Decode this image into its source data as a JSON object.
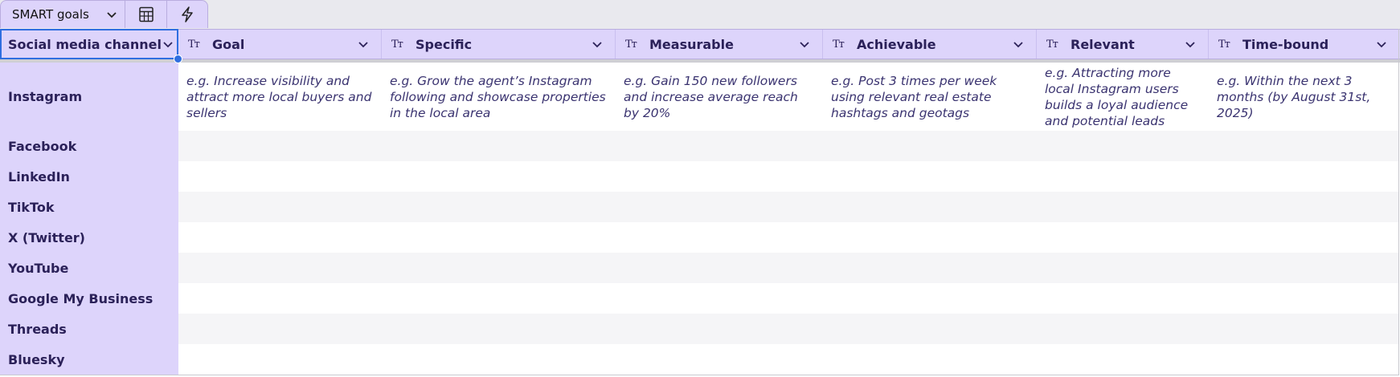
{
  "tabs": {
    "view_label": "SMART goals",
    "calc_icon": "calculator-icon",
    "bolt_icon": "lightning-icon"
  },
  "columns": [
    {
      "label": "Social media channel",
      "type_icon": ""
    },
    {
      "label": "Goal",
      "type_icon": "Tт"
    },
    {
      "label": "Specific",
      "type_icon": "Tт"
    },
    {
      "label": "Measurable",
      "type_icon": "Tт"
    },
    {
      "label": "Achievable",
      "type_icon": "Tт"
    },
    {
      "label": "Relevant",
      "type_icon": "Tт"
    },
    {
      "label": "Time-bound",
      "type_icon": "Tт"
    }
  ],
  "rows": [
    {
      "channel": "Instagram",
      "cells": [
        "e.g. Increase visibility and attract more local buyers and sellers",
        "e.g. Grow the agent’s Instagram following and showcase properties in the local area",
        "e.g. Gain 150 new followers and increase average reach by 20%",
        "e.g. Post 3 times per week using relevant real estate hashtags and geotags",
        "e.g. Attracting more local Instagram users builds a loyal audience and potential leads",
        "e.g. Within the next 3 months (by August 31st, 2025)"
      ]
    },
    {
      "channel": "Facebook",
      "cells": [
        "",
        "",
        "",
        "",
        "",
        ""
      ]
    },
    {
      "channel": "LinkedIn",
      "cells": [
        "",
        "",
        "",
        "",
        "",
        ""
      ]
    },
    {
      "channel": "TikTok",
      "cells": [
        "",
        "",
        "",
        "",
        "",
        ""
      ]
    },
    {
      "channel": "X (Twitter)",
      "cells": [
        "",
        "",
        "",
        "",
        "",
        ""
      ]
    },
    {
      "channel": "YouTube",
      "cells": [
        "",
        "",
        "",
        "",
        "",
        ""
      ]
    },
    {
      "channel": "Google My Business",
      "cells": [
        "",
        "",
        "",
        "",
        "",
        ""
      ]
    },
    {
      "channel": "Threads",
      "cells": [
        "",
        "",
        "",
        "",
        "",
        ""
      ]
    },
    {
      "channel": "Bluesky",
      "cells": [
        "",
        "",
        "",
        "",
        "",
        ""
      ]
    }
  ],
  "colors": {
    "header_bg": "#ddd4fb",
    "selection": "#2f6ee0",
    "text": "#2b2159"
  }
}
